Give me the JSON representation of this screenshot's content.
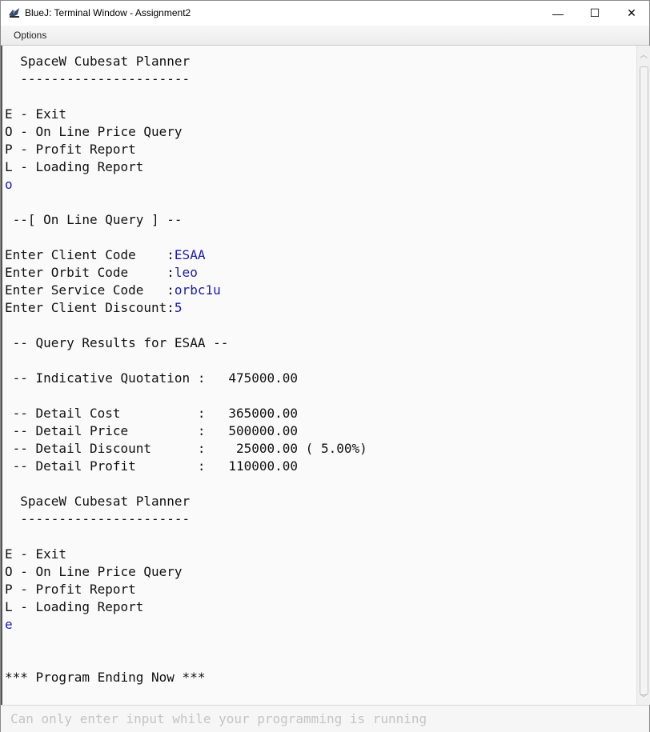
{
  "window": {
    "title": "BlueJ: Terminal Window - Assignment2",
    "app_icon": "bluej-icon",
    "controls": {
      "minimize": "—",
      "maximize": "☐",
      "close": "✕"
    }
  },
  "menu": {
    "options_label": "Options"
  },
  "terminal": {
    "input_color": "#1c1ca8",
    "lines": [
      {
        "text": "  SpaceW Cubesat Planner"
      },
      {
        "text": "  ----------------------"
      },
      {
        "text": ""
      },
      {
        "text": "E - Exit"
      },
      {
        "text": "O - On Line Price Query"
      },
      {
        "text": "P - Profit Report"
      },
      {
        "text": "L - Loading Report"
      },
      {
        "text": "",
        "input": "o"
      },
      {
        "text": ""
      },
      {
        "text": " --[ On Line Query ] --"
      },
      {
        "text": ""
      },
      {
        "text": "Enter Client Code    :",
        "input": "ESAA"
      },
      {
        "text": "Enter Orbit Code     :",
        "input": "leo"
      },
      {
        "text": "Enter Service Code   :",
        "input": "orbc1u"
      },
      {
        "text": "Enter Client Discount:",
        "input": "5"
      },
      {
        "text": ""
      },
      {
        "text": " -- Query Results for ESAA --"
      },
      {
        "text": ""
      },
      {
        "text": " -- Indicative Quotation :   475000.00"
      },
      {
        "text": ""
      },
      {
        "text": " -- Detail Cost          :   365000.00"
      },
      {
        "text": " -- Detail Price         :   500000.00"
      },
      {
        "text": " -- Detail Discount      :    25000.00 ( 5.00%)"
      },
      {
        "text": " -- Detail Profit        :   110000.00"
      },
      {
        "text": ""
      },
      {
        "text": "  SpaceW Cubesat Planner"
      },
      {
        "text": "  ----------------------"
      },
      {
        "text": ""
      },
      {
        "text": "E - Exit"
      },
      {
        "text": "O - On Line Price Query"
      },
      {
        "text": "P - Profit Report"
      },
      {
        "text": "L - Loading Report"
      },
      {
        "text": "",
        "input": "e"
      },
      {
        "text": ""
      },
      {
        "text": ""
      },
      {
        "text": "*** Program Ending Now ***"
      }
    ]
  },
  "input_bar": {
    "placeholder": "Can only enter input while your programming is running",
    "value": ""
  }
}
